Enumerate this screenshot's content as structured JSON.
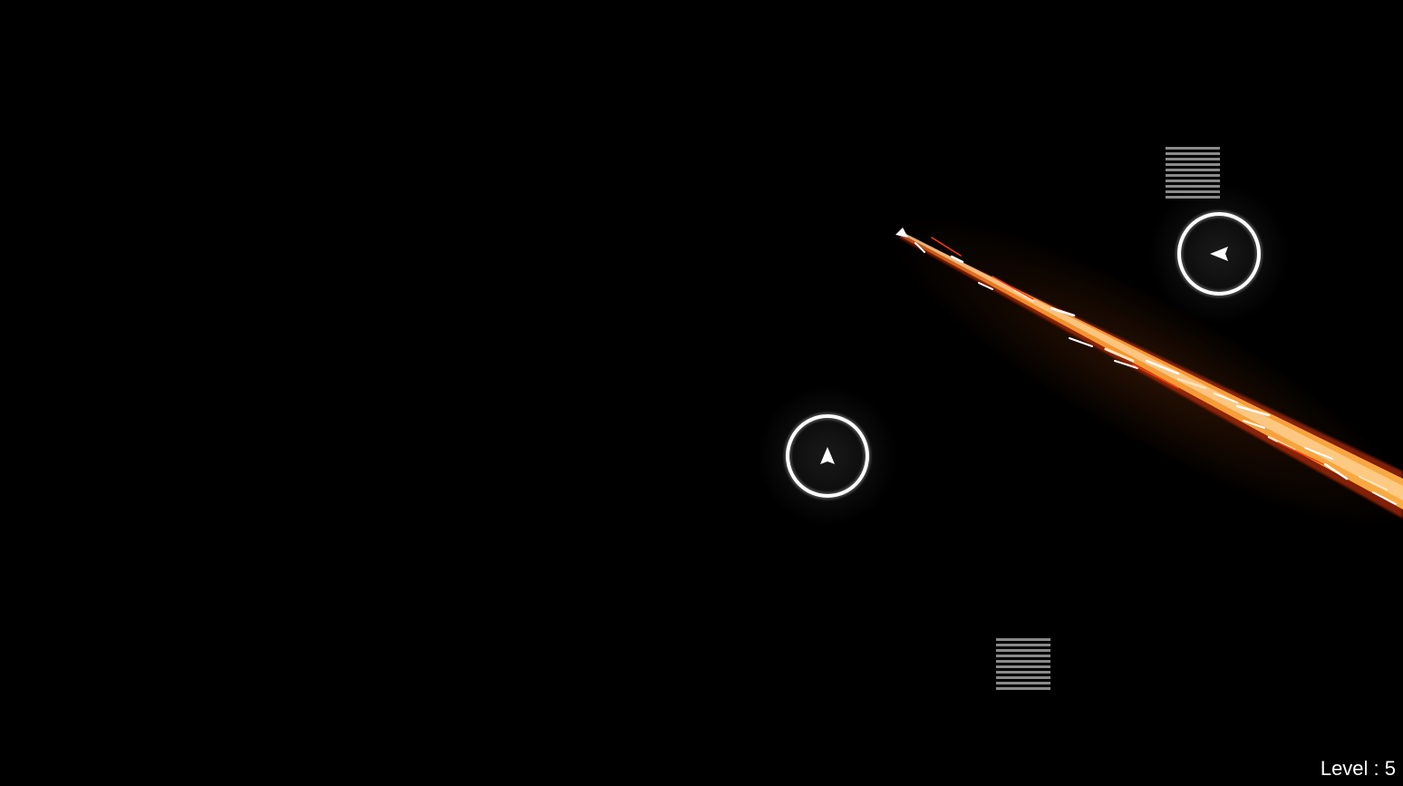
{
  "hud": {
    "level_label": "Level : 5"
  },
  "colors": {
    "background": "#000000",
    "ring": "#ffffff",
    "arrow": "#ffffff",
    "block": "#8a8a8a",
    "trail_core": "#ffe2b0",
    "trail_mid": "#ff9a2e",
    "trail_outer": "#e8380a"
  },
  "icons": {
    "turret": "ring-with-arrow-icon",
    "block": "striped-block-icon",
    "player": "white-arrow-ship-icon"
  },
  "turrets": [
    {
      "name": "turret-center",
      "heading_deg": 0
    },
    {
      "name": "turret-upper-right",
      "heading_deg": -90
    }
  ],
  "blocks": [
    {
      "name": "block-upper-right"
    },
    {
      "name": "block-lower-center"
    }
  ],
  "player": {
    "trail": "fire-trail"
  }
}
